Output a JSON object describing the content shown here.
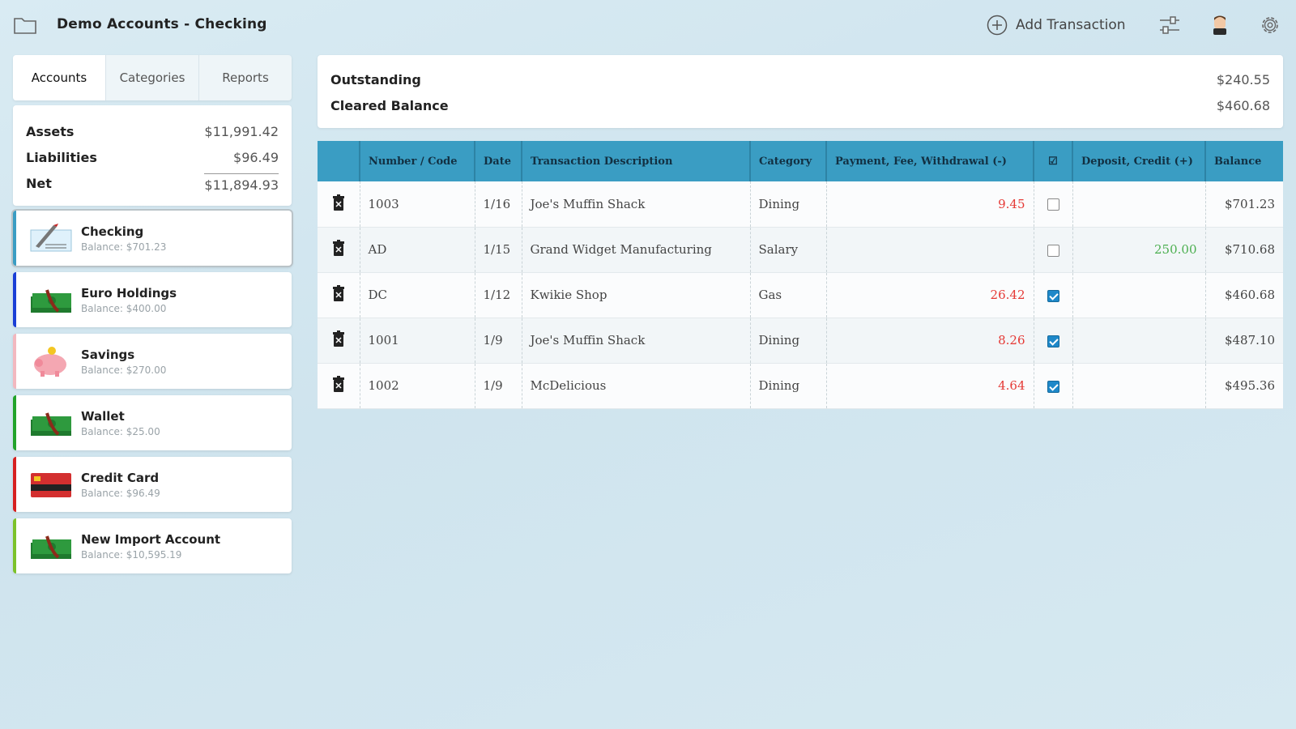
{
  "header": {
    "title": "Demo Accounts - Checking",
    "add_transaction": "Add Transaction"
  },
  "sidebar": {
    "tabs": [
      {
        "label": "Accounts"
      },
      {
        "label": "Categories"
      },
      {
        "label": "Reports"
      }
    ],
    "summary": {
      "assets_label": "Assets",
      "assets": "$11,991.42",
      "liabilities_label": "Liabilities",
      "liabilities": "$96.49",
      "net_label": "Net",
      "net": "$11,894.93"
    },
    "accounts": [
      {
        "name": "Checking",
        "balance": "Balance: $701.23",
        "color": "#3a9dc3"
      },
      {
        "name": "Euro Holdings",
        "balance": "Balance: $400.00",
        "color": "#1a3fd6"
      },
      {
        "name": "Savings",
        "balance": "Balance: $270.00",
        "color": "#f2b8bf"
      },
      {
        "name": "Wallet",
        "balance": "Balance: $25.00",
        "color": "#22a32a"
      },
      {
        "name": "Credit Card",
        "balance": "Balance: $96.49",
        "color": "#d62020"
      },
      {
        "name": "New Import Account",
        "balance": "Balance: $10,595.19",
        "color": "#7cc22a"
      }
    ]
  },
  "outstanding": {
    "outstanding_label": "Outstanding",
    "outstanding": "$240.55",
    "cleared_label": "Cleared Balance",
    "cleared": "$460.68"
  },
  "ledger": {
    "columns": [
      "Number / Code",
      "Date",
      "Transaction Description",
      "Category",
      "Payment, Fee, Withdrawal (-)",
      "☑",
      "Deposit, Credit (+)",
      "Balance"
    ],
    "rows": [
      {
        "number": "1003",
        "date": "1/16",
        "desc": "Joe's Muffin Shack",
        "category": "Dining",
        "payment": "9.45",
        "cleared": false,
        "deposit": "",
        "balance": "$701.23"
      },
      {
        "number": "AD",
        "date": "1/15",
        "desc": "Grand Widget Manufacturing",
        "category": "Salary",
        "payment": "",
        "cleared": false,
        "deposit": "250.00",
        "balance": "$710.68"
      },
      {
        "number": "DC",
        "date": "1/12",
        "desc": "Kwikie Shop",
        "category": "Gas",
        "payment": "26.42",
        "cleared": true,
        "deposit": "",
        "balance": "$460.68"
      },
      {
        "number": "1001",
        "date": "1/9",
        "desc": "Joe's Muffin Shack",
        "category": "Dining",
        "payment": "8.26",
        "cleared": true,
        "deposit": "",
        "balance": "$487.10"
      },
      {
        "number": "1002",
        "date": "1/9",
        "desc": "McDelicious",
        "category": "Dining",
        "payment": "4.64",
        "cleared": true,
        "deposit": "",
        "balance": "$495.36"
      }
    ]
  },
  "colors": {
    "header_blue": "#3a9dc3",
    "debit_red": "#e53935",
    "credit_green": "#4caf50"
  }
}
